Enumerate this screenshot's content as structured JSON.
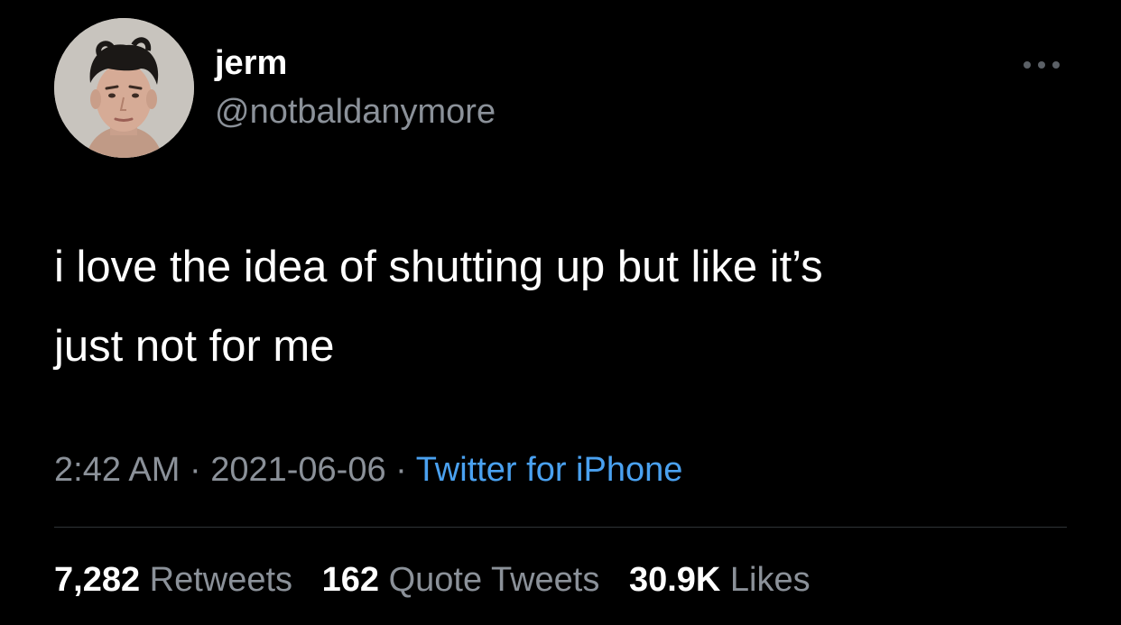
{
  "author": {
    "name": "jerm",
    "handle": "@notbaldanymore",
    "avatar_icon": "user-avatar-photo"
  },
  "tweet": {
    "text_line_1": "i love the idea of shutting up but like it’s",
    "text_line_2": "just not for me"
  },
  "meta": {
    "time": "2:42 AM",
    "separator_1": " · ",
    "date": "2021-06-06",
    "separator_2": " · ",
    "source": "Twitter for iPhone"
  },
  "stats": {
    "retweets_count": "7,282",
    "retweets_label": "Retweets",
    "quotes_count": "162",
    "quotes_label": "Quote Tweets",
    "likes_count": "30.9K",
    "likes_label": "Likes"
  },
  "colors": {
    "background": "#000000",
    "primary_text": "#ffffff",
    "secondary_text": "#8b9199",
    "link": "#4aa1f0",
    "divider": "#2f3336"
  },
  "icons": {
    "more": "more-horizontal-icon"
  }
}
